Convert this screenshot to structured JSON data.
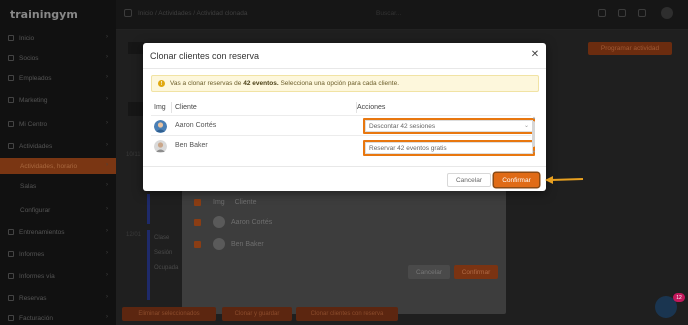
{
  "app": {
    "logo": "trainingym",
    "breadcrumb": "Inicio  /  Actividades  /  Actividad clonada",
    "search_placeholder": "Buscar..."
  },
  "sidebar": {
    "items": [
      {
        "label": "Inicio"
      },
      {
        "label": "Socios"
      },
      {
        "label": "Empleados"
      },
      {
        "label": "Marketing"
      },
      {
        "label": "Mi Centro"
      },
      {
        "label": "Actividades"
      },
      {
        "label": "Actividades, horario",
        "sub": true,
        "active": true
      },
      {
        "label": "Salas",
        "sub": true
      },
      {
        "label": "Configurar",
        "sub": true
      },
      {
        "label": "Entrenamientos"
      },
      {
        "label": "Informes"
      },
      {
        "label": "Informes vía"
      },
      {
        "label": "Reservas"
      },
      {
        "label": "Facturación"
      }
    ]
  },
  "background": {
    "top_right_button": "Programar actividad",
    "dates": [
      "10/11",
      "12/01"
    ],
    "panel": {
      "col_img": "Img",
      "col_cliente": "Cliente",
      "rows": [
        {
          "name": "Aaron Cortés"
        },
        {
          "name": "Ben Baker"
        }
      ],
      "cancel_label": "Cancelar",
      "confirm_label": "Confirmar"
    },
    "bottom_buttons": [
      "Eliminar seleccionados",
      "Clonar y guardar",
      "Clonar clientes con reserva"
    ],
    "chat_badge": "12",
    "left_labels": [
      "Clase",
      "Sesión",
      "Ocupada"
    ]
  },
  "modal": {
    "title": "Clonar clientes con reserva",
    "alert": {
      "prefix": "Vas a clonar reservas de ",
      "count": "42 eventos.",
      "suffix": " Selecciona una opción para cada cliente."
    },
    "table": {
      "headers": {
        "img": "Img",
        "cliente": "Cliente",
        "acciones": "Acciones"
      },
      "rows": [
        {
          "name": "Aaron Cortés",
          "action": "Descontar 42 sesiones"
        },
        {
          "name": "Ben Baker",
          "action": "Reservar 42 eventos gratis"
        }
      ]
    },
    "cancel_label": "Cancelar",
    "confirm_label": "Confirmar"
  },
  "colors": {
    "accent_orange": "#e06b16",
    "highlight_orange": "#e8770f",
    "alert_bg": "#fdf7dc"
  }
}
